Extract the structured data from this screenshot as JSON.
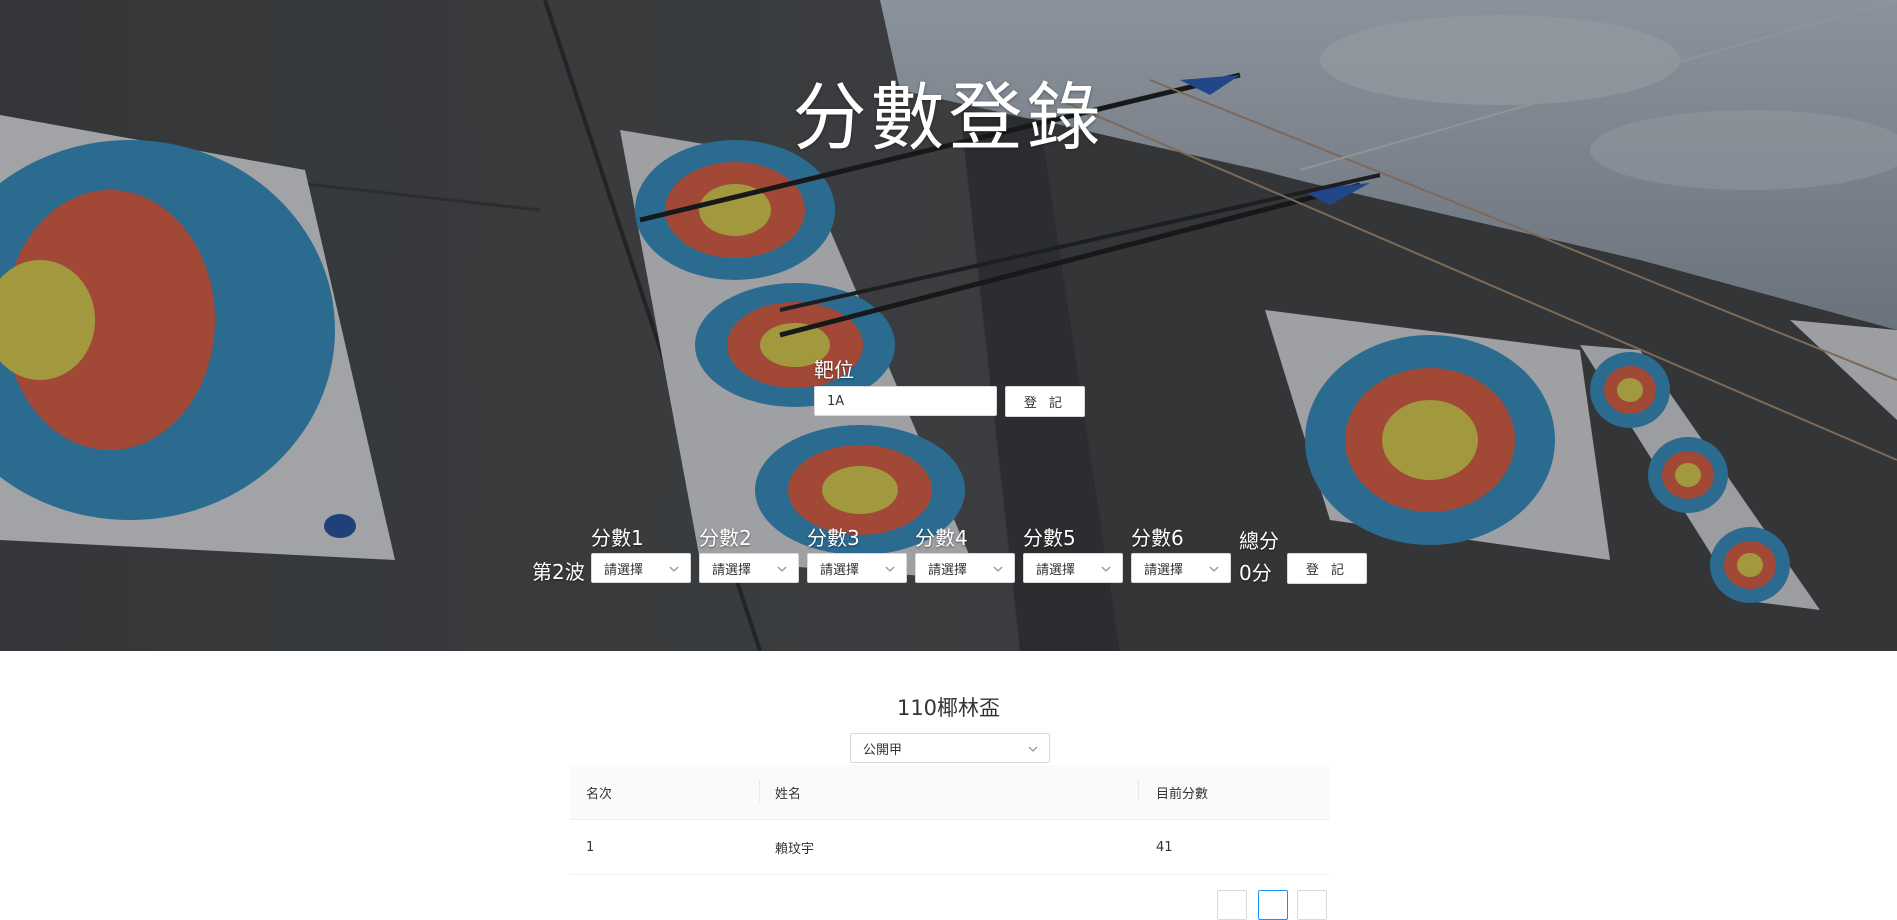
{
  "hero": {
    "title": "分數登錄"
  },
  "target": {
    "label": "靶位",
    "value": "1A",
    "submit": "登 記"
  },
  "scores": {
    "wave": "第2波",
    "fields": [
      {
        "label": "分數1",
        "value": "請選擇"
      },
      {
        "label": "分數2",
        "value": "請選擇"
      },
      {
        "label": "分數3",
        "value": "請選擇"
      },
      {
        "label": "分數4",
        "value": "請選擇"
      },
      {
        "label": "分數5",
        "value": "請選擇"
      },
      {
        "label": "分數6",
        "value": "請選擇"
      }
    ],
    "total_label": "總分",
    "total_value": "0分",
    "submit": "登 記"
  },
  "ranking": {
    "title": "110椰林盃",
    "group": "公開甲",
    "columns": [
      "名次",
      "姓名",
      "目前分數"
    ],
    "rows": [
      [
        "1",
        "賴玟宇",
        "41"
      ]
    ]
  }
}
